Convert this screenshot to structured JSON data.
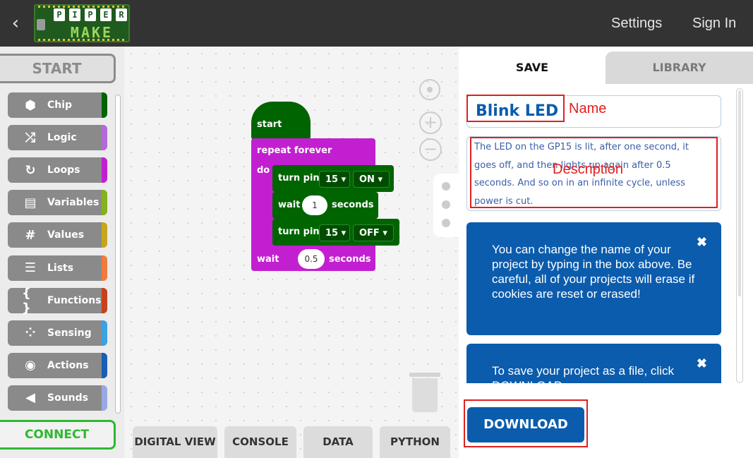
{
  "header": {
    "back_glyph": "‹",
    "logo_letters": [
      "P",
      "I",
      "P",
      "E",
      "R"
    ],
    "logo_word": "MAKE",
    "settings_label": "Settings",
    "signin_label": "Sign In"
  },
  "sidebar": {
    "start_label": "START",
    "connect_label": "CONNECT",
    "categories": [
      {
        "label": "Chip",
        "icon": "hexagon-icon",
        "glyph": "⬢",
        "color": "#006400"
      },
      {
        "label": "Logic",
        "icon": "shuffle-icon",
        "glyph": "⤮",
        "color": "#b26bd9"
      },
      {
        "label": "Loops",
        "icon": "loop-arrow-icon",
        "glyph": "↻",
        "color": "#c21fd1"
      },
      {
        "label": "Variables",
        "icon": "variable-box-icon",
        "glyph": "▤",
        "color": "#86b11d"
      },
      {
        "label": "Values",
        "icon": "hash-icon",
        "glyph": "#",
        "color": "#c7a61c"
      },
      {
        "label": "Lists",
        "icon": "list-icon",
        "glyph": "☰",
        "color": "#f07c3c"
      },
      {
        "label": "Functions",
        "icon": "braces-icon",
        "glyph": "{ }",
        "color": "#c7411c"
      },
      {
        "label": "Sensing",
        "icon": "sensing-dots-icon",
        "glyph": "⁘",
        "color": "#3aa3e3"
      },
      {
        "label": "Actions",
        "icon": "target-icon",
        "glyph": "◉",
        "color": "#1a5db5"
      },
      {
        "label": "Sounds",
        "icon": "speaker-icon",
        "glyph": "◀",
        "color": "#9aa9e3"
      }
    ]
  },
  "blocks": {
    "start_label": "start",
    "repeat_label": "repeat forever",
    "do_label": "do",
    "turn_pin_label": "turn pin",
    "pin_value": "15",
    "on_value": "ON",
    "off_value": "OFF",
    "wait_label": "wait",
    "wait1_value": "1",
    "wait2_value": "0.5",
    "seconds_label": "seconds",
    "dropdown_arrow": "▾"
  },
  "workspace_tabs": [
    "DIGITAL VIEW",
    "CONSOLE",
    "DATA",
    "PYTHON"
  ],
  "panel": {
    "tab_save": "SAVE",
    "tab_library": "LIBRARY",
    "project_name": "Blink LED",
    "description": "The LED on the GP15 is lit, after one second, it goes off, and then lights up again after 0.5 seconds. And so on in an infinite cycle, unless power is cut.",
    "info_card_1": "You can change the name of your project by typing in the box above. Be careful, all of your projects will erase if cookies are reset or erased!",
    "info_card_2": "To save your project as a file, click DOWNLOAD.",
    "close_glyph": "✖",
    "download_label": "DOWNLOAD"
  },
  "annotations": {
    "name_label": "Name",
    "description_label": "Description"
  },
  "colors": {
    "header_bg": "#333333",
    "block_green": "#006400",
    "block_purple": "#c21fd1",
    "panel_blue": "#0b5cad",
    "connect_green": "#2eb82e",
    "annotation_red": "#e02020"
  }
}
